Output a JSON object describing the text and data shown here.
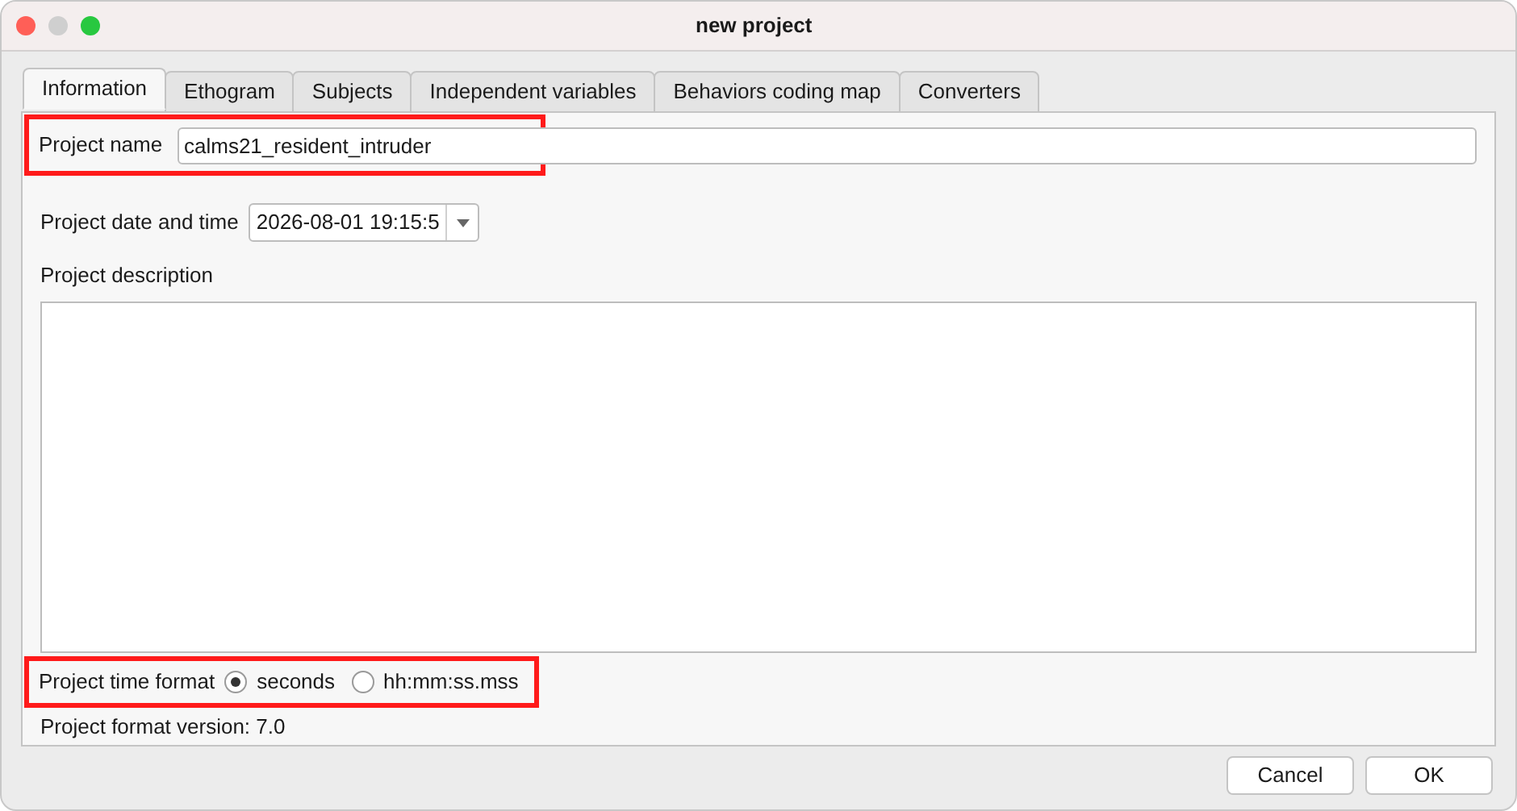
{
  "window": {
    "title": "new project"
  },
  "tabs": [
    {
      "label": "Information",
      "selected": true
    },
    {
      "label": "Ethogram",
      "selected": false
    },
    {
      "label": "Subjects",
      "selected": false
    },
    {
      "label": "Independent variables",
      "selected": false
    },
    {
      "label": "Behaviors coding map",
      "selected": false
    },
    {
      "label": "Converters",
      "selected": false
    }
  ],
  "project_name": {
    "label": "Project name",
    "value": "calms21_resident_intruder",
    "highlighted": true
  },
  "project_date": {
    "label": "Project date and time",
    "value": "2026-08-01 19:15:5"
  },
  "project_description": {
    "label": "Project description"
  },
  "time_format": {
    "label": "Project time format",
    "highlighted": true,
    "options": [
      {
        "label": "seconds",
        "selected": true
      },
      {
        "label": "hh:mm:ss.mss",
        "selected": false
      }
    ]
  },
  "format_version": "Project format version: 7.0",
  "buttons": [
    {
      "label": "Cancel",
      "default": false
    },
    {
      "label": "OK",
      "default": false
    }
  ]
}
